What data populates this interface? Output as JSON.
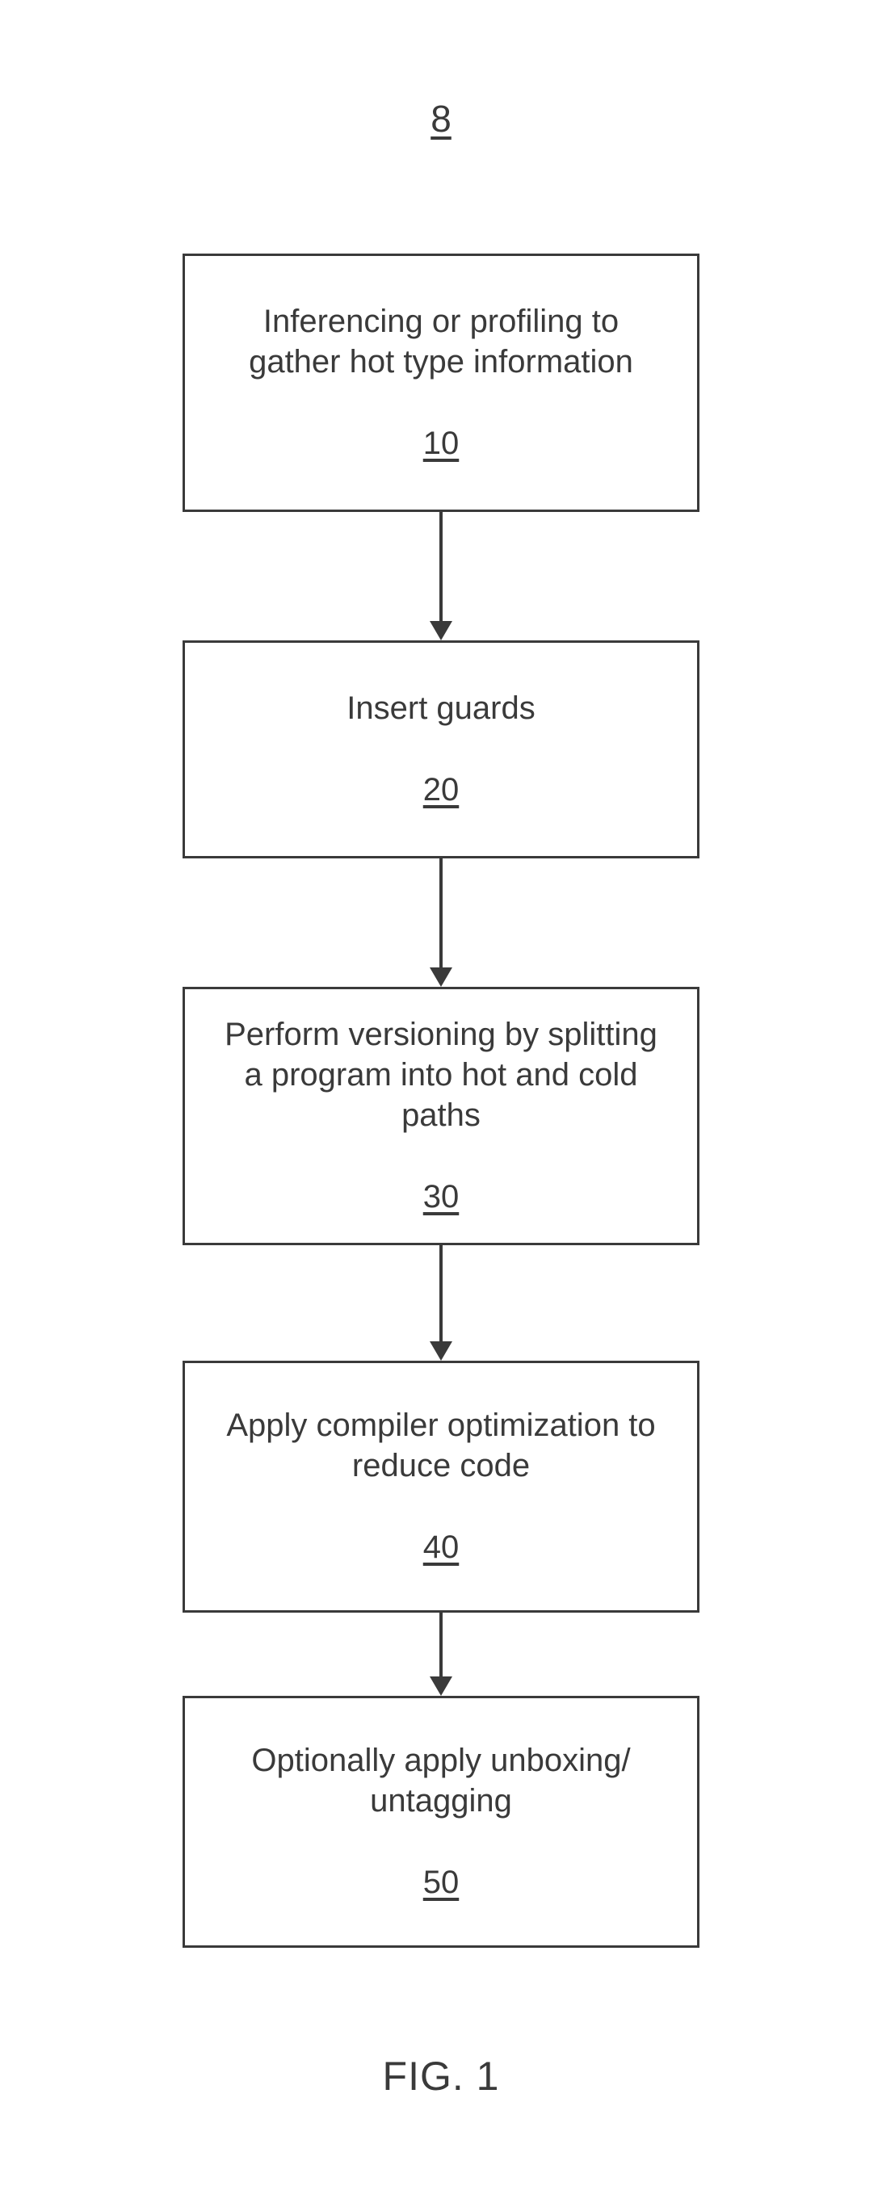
{
  "figure_number": "8",
  "caption": "FIG. 1",
  "steps": [
    {
      "text": "Inferencing or profiling to gather hot type information",
      "num": "10"
    },
    {
      "text": "Insert guards",
      "num": "20"
    },
    {
      "text": "Perform versioning by splitting a program into hot and cold paths",
      "num": "30"
    },
    {
      "text": "Apply compiler optimization to reduce code",
      "num": "40"
    },
    {
      "text": "Optionally apply unboxing/ untagging",
      "num": "50"
    }
  ]
}
